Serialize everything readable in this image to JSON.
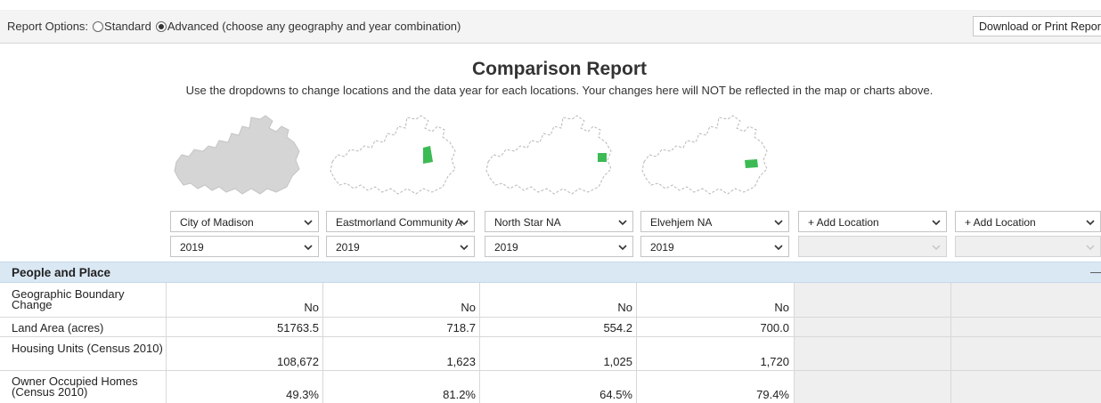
{
  "options": {
    "label": "Report Options:",
    "standard_label": "Standard",
    "advanced_label": "Advanced (choose any geography and year combination)",
    "selected": "Advanced"
  },
  "download_button": "Download or Print Report",
  "report": {
    "title": "Comparison Report",
    "subtitle": "Use the dropdowns to change locations and the data year for each locations. Your changes here will NOT be reflected in the map or charts above."
  },
  "colors": {
    "highlight": "#3cba54",
    "section_bg": "#dae8f4",
    "empty_col": "#efefef"
  },
  "locations": [
    {
      "name": "City of Madison",
      "year": "2019"
    },
    {
      "name": "Eastmorland Community A",
      "year": "2019"
    },
    {
      "name": "North Star NA",
      "year": "2019"
    },
    {
      "name": "Elvehjem NA",
      "year": "2019"
    },
    {
      "name": "+ Add Location",
      "year": ""
    },
    {
      "name": "+ Add Location",
      "year": ""
    }
  ],
  "section": {
    "label": "People and Place",
    "collapse_icon": "minus-icon"
  },
  "rows": [
    {
      "label": "Geographic Boundary Change",
      "values": [
        "No",
        "No",
        "No",
        "No"
      ]
    },
    {
      "label": "Land Area (acres)",
      "values": [
        "51763.5",
        "718.7",
        "554.2",
        "700.0"
      ]
    },
    {
      "label": "Housing Units (Census 2010)",
      "values": [
        "108,672",
        "1,623",
        "1,025",
        "1,720"
      ]
    },
    {
      "label": "Owner Occupied Homes (Census 2010)",
      "values": [
        "49.3%",
        "81.2%",
        "64.5%",
        "79.4%"
      ]
    }
  ]
}
